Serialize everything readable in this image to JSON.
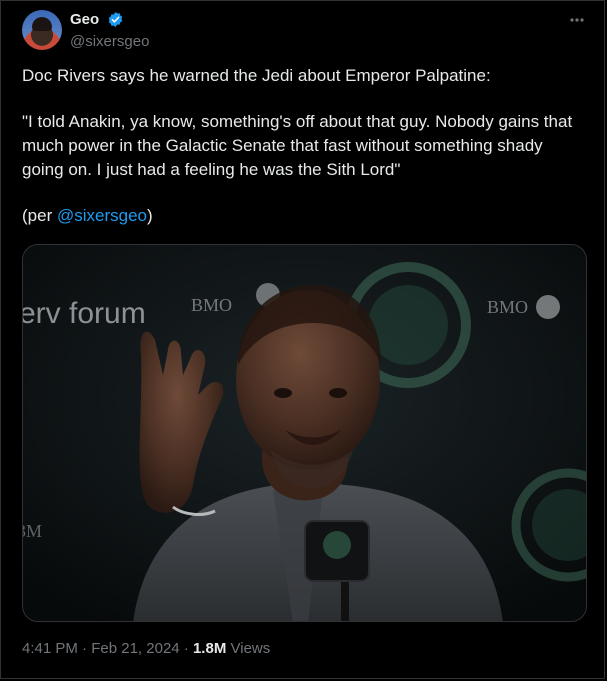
{
  "author": {
    "display_name": "Geo",
    "handle": "@sixersgeo",
    "verified": true,
    "avatar_icon": "user-avatar-photo"
  },
  "more_icon": "more-horizontal-icon",
  "tweet": {
    "line1": "Doc Rivers says he warned the Jedi about Emperor Palpatine:",
    "quote": "\"I told Anakin, ya know, something's off about that guy. Nobody gains that much power in the Galactic Senate that fast without something shady going on. I just had a feeling he was the Sith Lord\"",
    "per_prefix": "(per ",
    "per_mention": "@sixersgeo",
    "per_suffix": ")"
  },
  "media": {
    "description_icon": "press-conference-photo",
    "backdrop_text_left": "erv forum",
    "backdrop_text_bmo_1": "BMO",
    "backdrop_text_bmo_2": "BMO",
    "backdrop_text_bottom_left": "3M"
  },
  "meta": {
    "time": "4:41 PM",
    "separator": "·",
    "date": "Feb 21, 2024",
    "views_count": "1.8M",
    "views_label": "Views"
  },
  "colors": {
    "background": "#000000",
    "text": "#e7e9ea",
    "muted": "#71767b",
    "link": "#1d9bf0",
    "border": "#2f3336"
  }
}
